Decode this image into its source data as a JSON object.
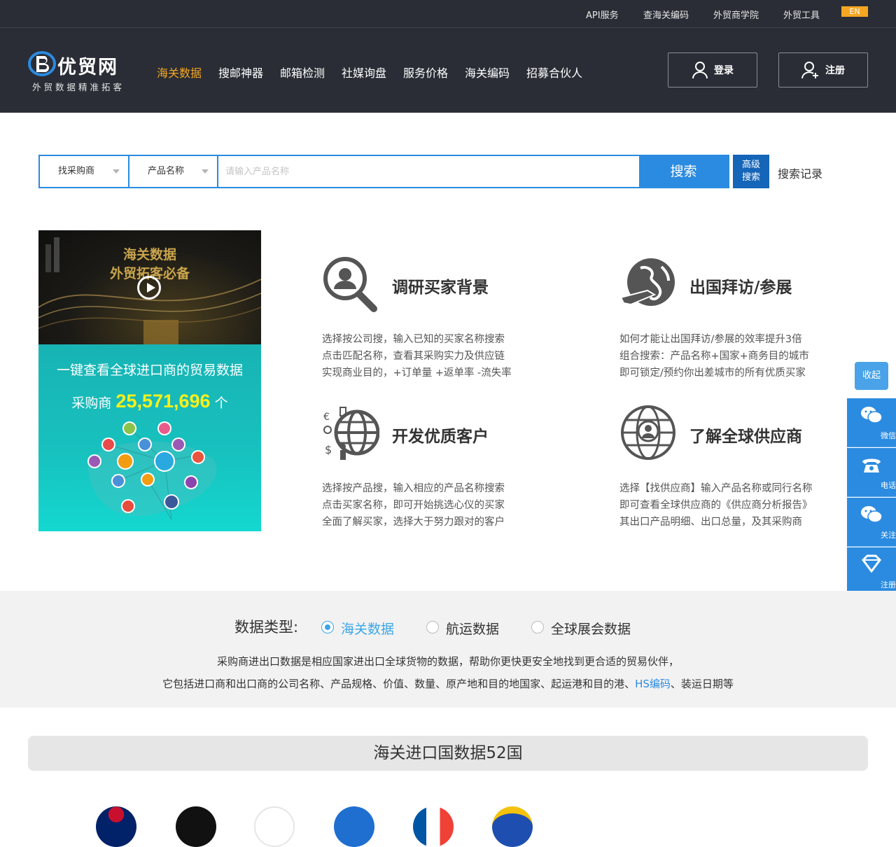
{
  "topbar": {
    "links": [
      "API服务",
      "查海关编码",
      "外贸商学院",
      "外贸工具"
    ],
    "lang": "EN"
  },
  "header": {
    "logo_name": "优贸网",
    "logo_sub": "外贸数据精准拓客",
    "nav": [
      "海关数据",
      "搜邮神器",
      "邮箱检测",
      "社媒询盘",
      "服务价格",
      "海关编码",
      "招募合伙人"
    ],
    "active_nav": "海关数据",
    "login": "登录",
    "register": "注册"
  },
  "search": {
    "type_select": "找采购商",
    "field_select": "产品名称",
    "placeholder": "请输入产品名称",
    "button": "搜索",
    "advanced_line1": "高级",
    "advanced_line2": "搜索",
    "history": "搜索记录"
  },
  "promo": {
    "title1": "海关数据",
    "title2": "外贸拓客必备",
    "line1": "一键查看全球进口商的贸易数据",
    "count_prefix": "采购商",
    "count": "25,571,696",
    "count_suffix": "个"
  },
  "features": [
    {
      "title": "调研买家背景",
      "icon": "search-person-icon",
      "lines": [
        "选择按公司搜，输入已知的买家名称搜索",
        "点击匹配名称，查看其采购实力及供应链",
        "实现商业目的，+订单量 +返单率 -流失率"
      ]
    },
    {
      "title": "出国拜访/参展",
      "icon": "globe-plane-icon",
      "lines": [
        "如何才能让出国拜访/参展的效率提升3倍",
        "组合搜索：产品名称+国家+商务目的城市",
        "即可锁定/预约你出差城市的所有优质买家"
      ]
    },
    {
      "title": "开发优质客户",
      "icon": "globe-business-icon",
      "lines": [
        "选择按产品搜，输入相应的产品名称搜索",
        "点击买家名称，即可开始挑选心仪的买家",
        "全面了解买家，选择大于努力跟对的客户"
      ]
    },
    {
      "title": "了解全球供应商",
      "icon": "globe-person-icon",
      "lines": [
        "选择【找供应商】输入产品名称或同行名称",
        "即可查看全球供应商的《供应商分析报告》",
        "其出口产品明细、出口总量，及其采购商"
      ]
    }
  ],
  "side": {
    "fold": "收起",
    "items": [
      "微信咨询",
      "电话咨询",
      "关注微信",
      "注册试用"
    ]
  },
  "data_type": {
    "label": "数据类型:",
    "options": [
      "海关数据",
      "航运数据",
      "全球展会数据"
    ],
    "selected": "海关数据",
    "desc1": "采购商进出口数据是相应国家进出口全球货物的数据，帮助你更快更安全地找到更合适的贸易伙伴，",
    "desc2_pre": "它包括进口商和出口商的公司名称、产品规格、价值、数量、原产地和目的地国家、起运港和目的港、",
    "desc2_link": "HS编码",
    "desc2_post": "、装运日期等"
  },
  "countries": {
    "title": "海关进口国数据52国"
  },
  "colors": {
    "accent": "#2b8be0",
    "nav_active": "#f5a623",
    "header_bg": "#2a2d35"
  }
}
